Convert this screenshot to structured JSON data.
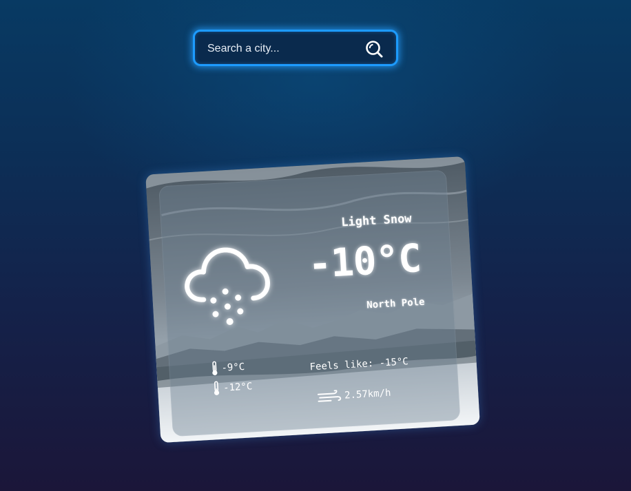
{
  "search": {
    "placeholder": "Search a city..."
  },
  "weather": {
    "condition": "Light Snow",
    "temperature": "-10°C",
    "location": "North Pole",
    "temp_max": "-9°C",
    "temp_min": "-12°C",
    "feels_like": "Feels like: -15°C",
    "wind_speed": "2.57km/h"
  },
  "icons": {
    "search": "search-icon",
    "weather": "snow-cloud-icon",
    "temp_max": "thermometer-icon",
    "temp_min": "thermometer-icon",
    "wind": "wind-icon"
  },
  "colors": {
    "accent": "#1d9bff",
    "text": "#ffffff"
  }
}
